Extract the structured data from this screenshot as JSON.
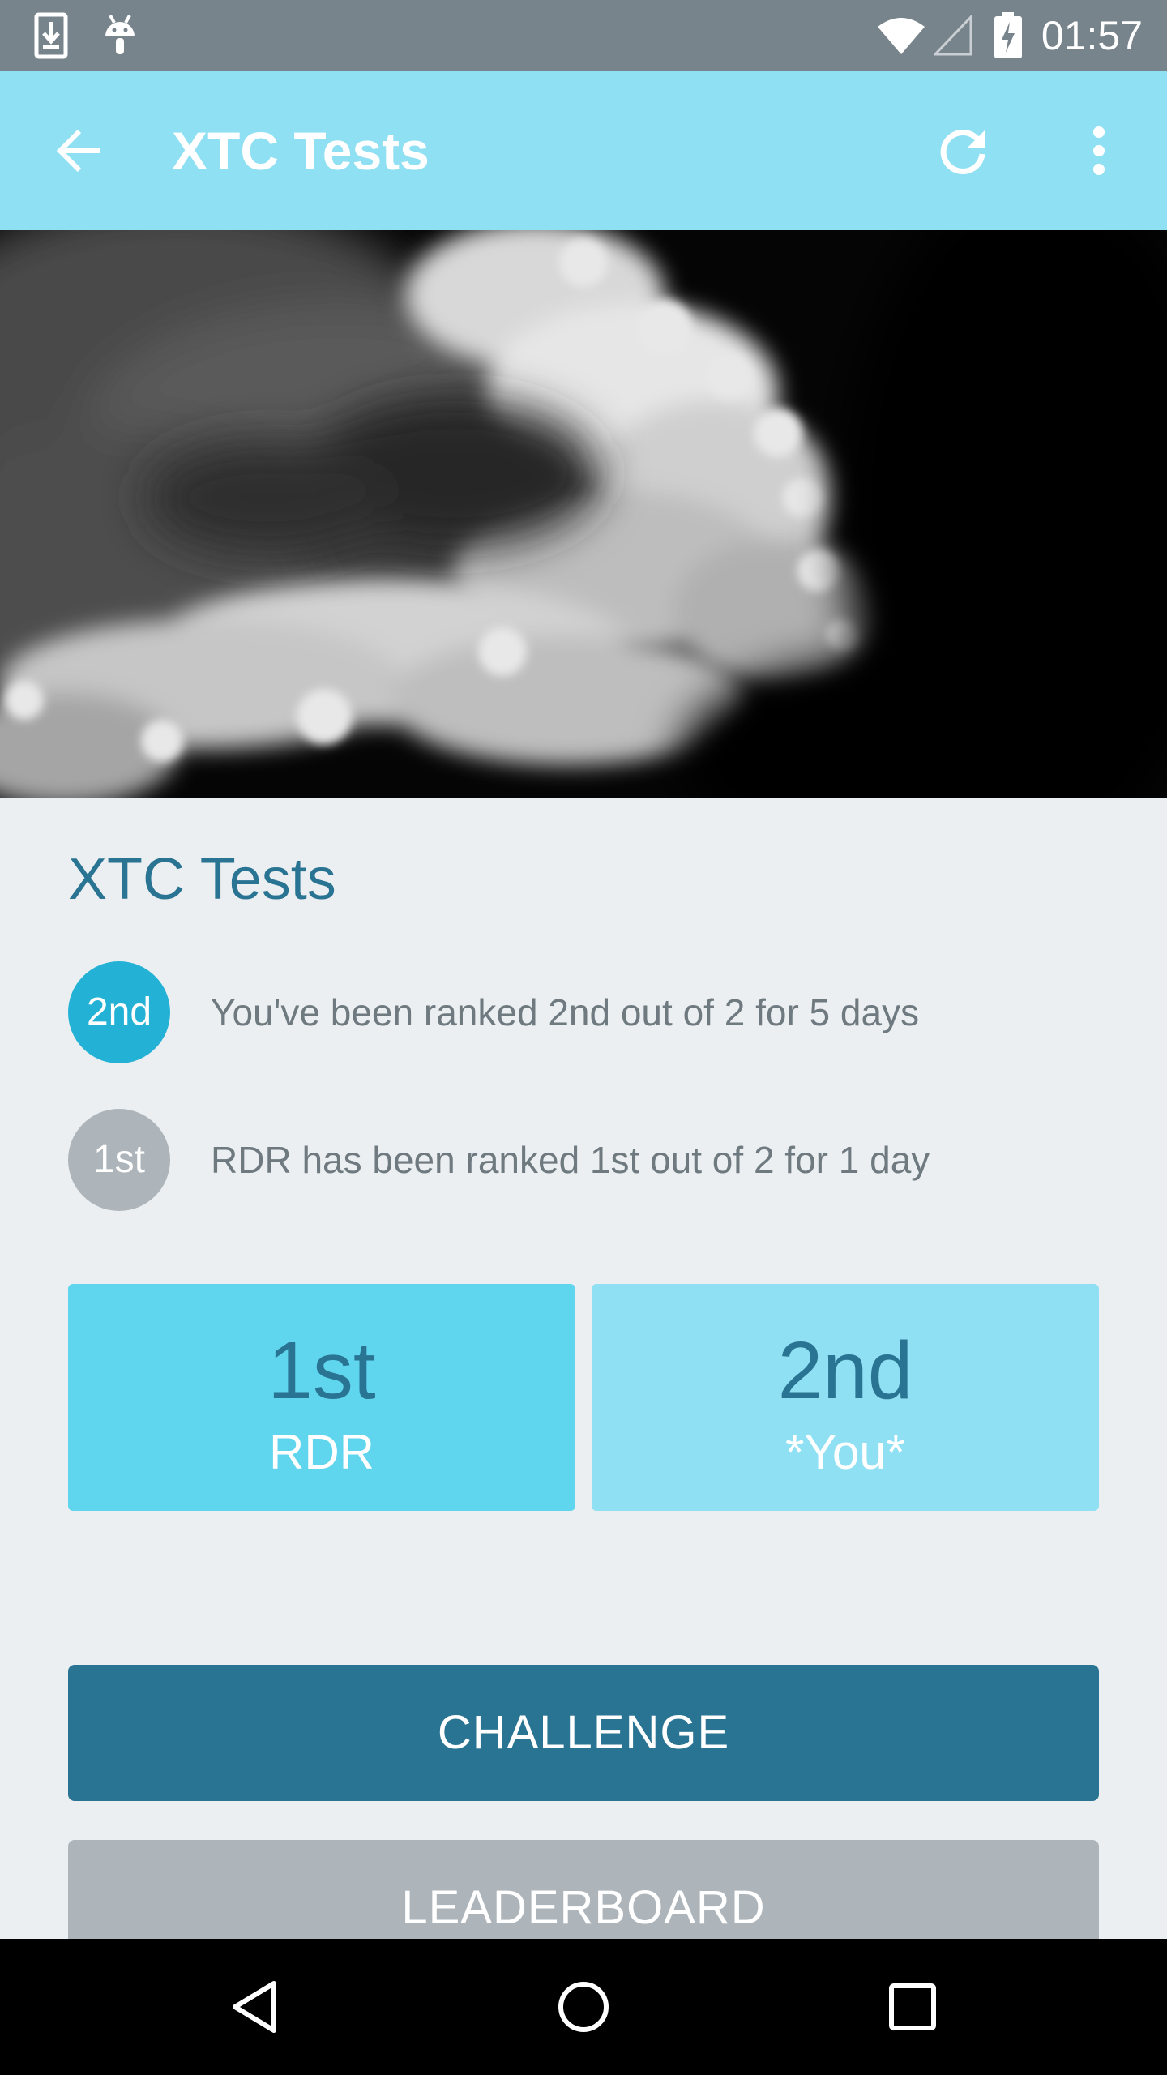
{
  "status_bar": {
    "time": "01:57",
    "icons": [
      "download-icon",
      "android-icon",
      "wifi-icon",
      "signal-icon",
      "battery-charging-icon"
    ]
  },
  "app_bar": {
    "title": "XTC Tests",
    "icons": [
      "back-arrow-icon",
      "refresh-icon",
      "overflow-menu-icon"
    ],
    "background_color": "#90e0f3"
  },
  "hero": {
    "image": "cloud-image"
  },
  "content": {
    "title": "XTC Tests",
    "rankings": [
      {
        "badge": "2nd",
        "text": "You've been ranked 2nd out of 2 for 5 days",
        "badge_color": "#23b2d6"
      },
      {
        "badge": "1st",
        "text": "RDR has been ranked 1st out of 2 for 1 day",
        "badge_color": "#aeb5ba"
      }
    ],
    "leaderboard_cards": [
      {
        "rank": "1st",
        "name": "RDR",
        "color": "#5fd5ee"
      },
      {
        "rank": "2nd",
        "name": "*You*",
        "color": "#90e0f3"
      }
    ],
    "buttons": {
      "challenge": "CHALLENGE",
      "leaderboard": "LEADERBOARD"
    },
    "colors": {
      "challenge": "#2a7493",
      "leaderboard": "#aeb5ba"
    }
  },
  "nav_bar": {
    "icons": [
      "back-triangle-icon",
      "home-circle-icon",
      "recents-square-icon"
    ]
  }
}
